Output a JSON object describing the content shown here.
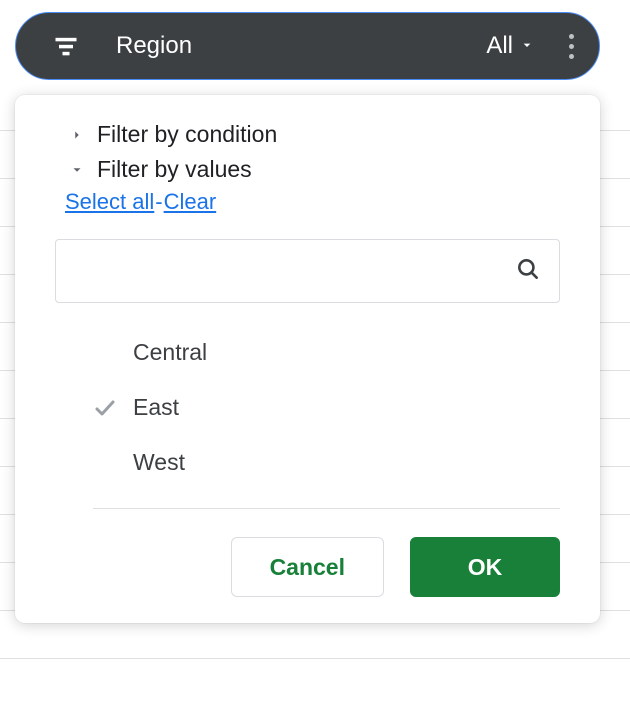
{
  "slicer": {
    "field_label": "Region",
    "summary_label": "All"
  },
  "popup": {
    "filter_by_condition_label": "Filter by condition",
    "filter_by_values_label": "Filter by values",
    "select_all_label": "Select all",
    "clear_label": "Clear",
    "link_separator": "-",
    "search_placeholder": "",
    "values": [
      {
        "label": "Central",
        "checked": false
      },
      {
        "label": "East",
        "checked": true
      },
      {
        "label": "West",
        "checked": false
      }
    ],
    "cancel_label": "Cancel",
    "ok_label": "OK"
  }
}
